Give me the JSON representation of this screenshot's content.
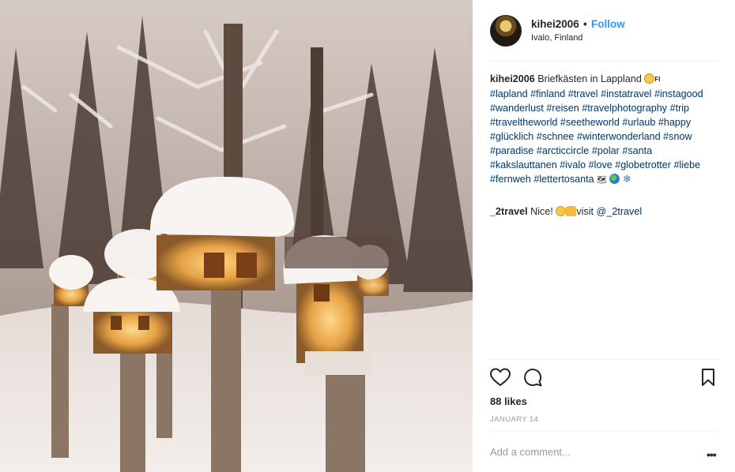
{
  "header": {
    "username": "kihei2006",
    "separator": "•",
    "follow_label": "Follow",
    "location": "Ivalo, Finland"
  },
  "caption": {
    "username": "kihei2006",
    "text": "Briefkästen in Lappland",
    "emoji_flag_text": "FI",
    "hashtags": [
      "#lapland",
      "#finland",
      "#travel",
      "#instatravel",
      "#instagood",
      "#wanderlust",
      "#reisen",
      "#travelphotography",
      "#trip",
      "#traveltheworld",
      "#seetheworld",
      "#urlaub",
      "#happy",
      "#glücklich",
      "#schnee",
      "#winterwonderland",
      "#snow",
      "#paradise",
      "#arcticcircle",
      "#polar",
      "#santa",
      "#kakslauttanen",
      "#ivalo",
      "#love",
      "#globetrotter",
      "#liebe",
      "#fernweh",
      "#lettertosanta"
    ],
    "trailing_emojis": [
      "🗺",
      "🌍",
      "❄"
    ]
  },
  "comment": {
    "username": "_2travel",
    "text": "Nice!",
    "visit_text": "visit",
    "mention": "@_2travel"
  },
  "likes_label": "88 likes",
  "date_label": "JANUARY 14",
  "add_comment_placeholder": "Add a comment...",
  "more_label": "•••",
  "icons": {
    "like": "heart-icon",
    "comment": "comment-bubble-icon",
    "save": "bookmark-icon"
  },
  "colors": {
    "follow": "#3897f0",
    "hashtag": "#003569",
    "muted": "#999999",
    "text": "#262626"
  }
}
